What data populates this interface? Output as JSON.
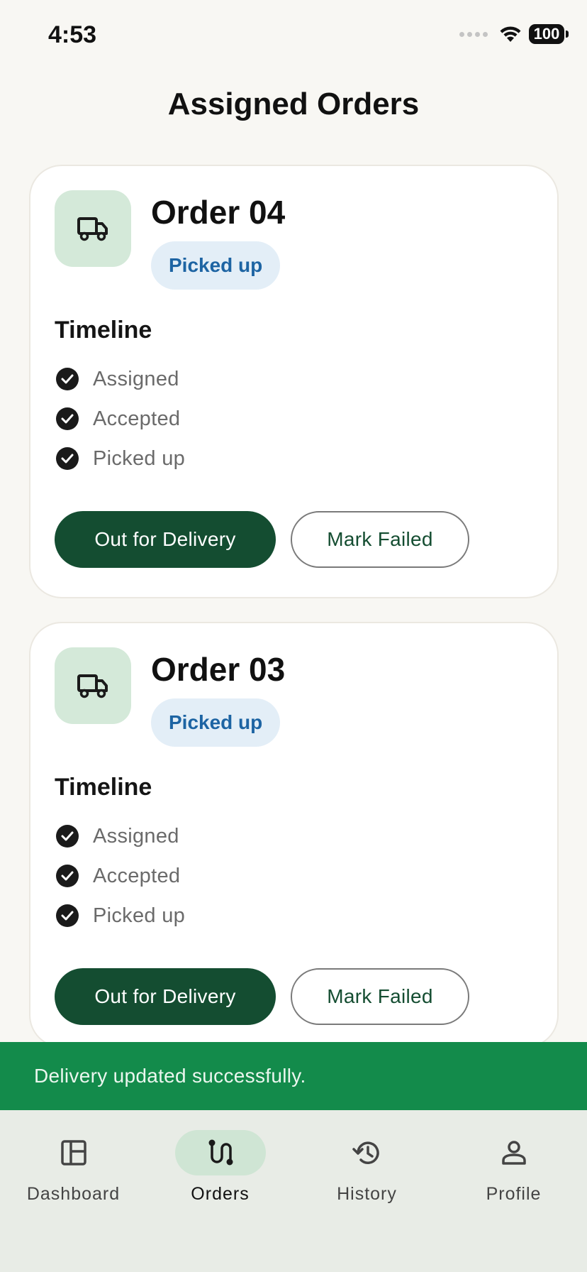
{
  "status_bar": {
    "time": "4:53",
    "battery": "100"
  },
  "page": {
    "title": "Assigned Orders"
  },
  "orders": [
    {
      "title": "Order 04",
      "status": "Picked up",
      "timeline_heading": "Timeline",
      "timeline": [
        "Assigned",
        "Accepted",
        "Picked up"
      ],
      "primary_action": "Out for Delivery",
      "secondary_action": "Mark Failed"
    },
    {
      "title": "Order 03",
      "status": "Picked up",
      "timeline_heading": "Timeline",
      "timeline": [
        "Assigned",
        "Accepted",
        "Picked up"
      ],
      "primary_action": "Out for Delivery",
      "secondary_action": "Mark Failed"
    }
  ],
  "snackbar": {
    "message": "Delivery updated successfully."
  },
  "nav": {
    "items": [
      {
        "label": "Dashboard",
        "icon": "dashboard-icon",
        "active": false
      },
      {
        "label": "Orders",
        "icon": "route-icon",
        "active": true
      },
      {
        "label": "History",
        "icon": "history-icon",
        "active": false
      },
      {
        "label": "Profile",
        "icon": "person-icon",
        "active": false
      }
    ]
  },
  "colors": {
    "accent_green": "#144d31",
    "snackbar_green": "#138b4b",
    "chip_blue_text": "#1d64a3",
    "chip_blue_bg": "#e3eef7",
    "icon_box_green": "#d4e9d9"
  }
}
